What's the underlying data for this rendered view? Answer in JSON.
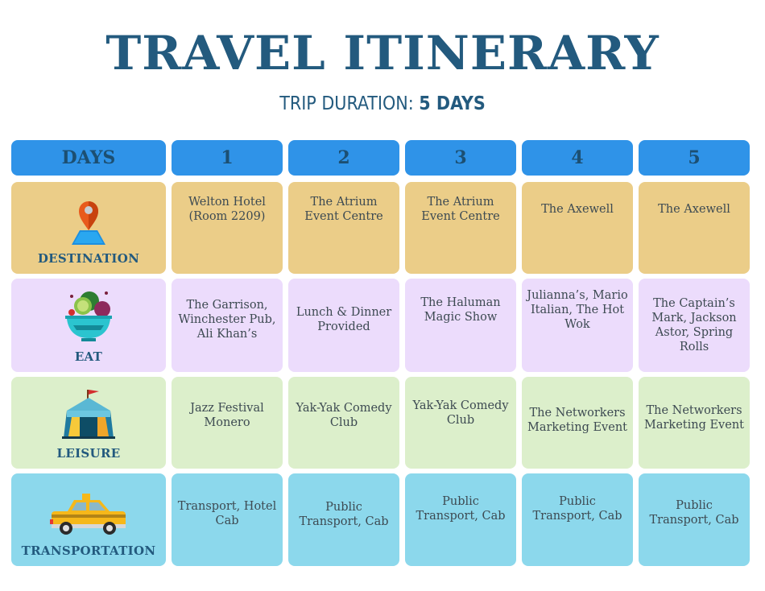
{
  "header": {
    "title": "TRAVEL ITINERARY",
    "subtitle_prefix": "TRIP DURATION: ",
    "subtitle_value": "5 DAYS"
  },
  "colors": {
    "title": "#235a7e",
    "header_row": "#2f93e8",
    "destination_row": "#ebcd88",
    "eat_row": "#ecdcfc",
    "leisure_row": "#dcefcb",
    "transportation_row": "#8cd8ec"
  },
  "table": {
    "corner_label": "DAYS",
    "days": [
      "1",
      "2",
      "3",
      "4",
      "5"
    ],
    "rows": [
      {
        "label": "DESTINATION",
        "icon": "map-pin-icon",
        "cells": [
          "Welton Hotel (Room 2209)",
          "The Atrium Event Centre",
          "The Atrium Event Centre",
          "The Axewell",
          "The Axewell"
        ]
      },
      {
        "label": "EAT",
        "icon": "salad-bowl-icon",
        "cells": [
          "The Garrison, Winchester Pub, Ali Khan’s",
          "Lunch & Dinner Provided",
          "The Haluman Magic Show",
          "Julianna’s, Mario Italian, The Hot Wok",
          "The Captain’s Mark, Jackson Astor, Spring Rolls"
        ]
      },
      {
        "label": "LEISURE",
        "icon": "circus-tent-icon",
        "cells": [
          "Jazz Festival Monero",
          "Yak-Yak Comedy Club",
          "Yak-Yak Comedy Club",
          "The Networkers Marketing Event",
          "The Networkers Marketing Event"
        ]
      },
      {
        "label": "TRANSPORTATION",
        "icon": "taxi-icon",
        "cells": [
          "Transport, Hotel Cab",
          "Public Transport, Cab",
          "Public Transport, Cab",
          "Public Transport, Cab",
          "Public Transport, Cab"
        ]
      }
    ]
  }
}
